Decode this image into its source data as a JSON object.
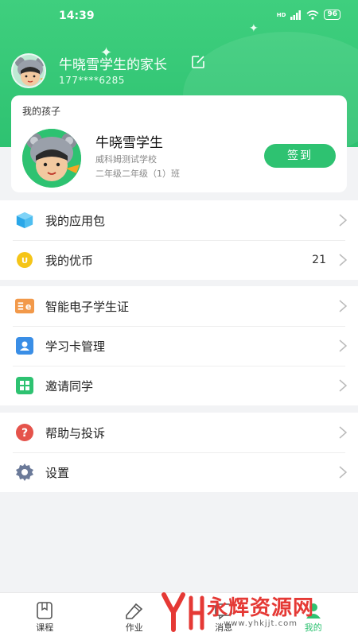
{
  "status_bar": {
    "time": "14:39",
    "network": "HD",
    "battery": "96"
  },
  "profile": {
    "parent_name": "牛晓雪学生的家长",
    "phone": "177****6285"
  },
  "child_card": {
    "section_label": "我的孩子",
    "child_name": "牛晓雪学生",
    "school": "威科姆测试学校",
    "class_name": "二年级二年级（1）班",
    "checkin_label": "签到"
  },
  "menu_group_1": [
    {
      "label": "我的应用包",
      "icon": "app-package-icon",
      "value": ""
    },
    {
      "label": "我的优币",
      "icon": "coin-icon",
      "value": "21"
    }
  ],
  "menu_group_2": [
    {
      "label": "智能电子学生证",
      "icon": "e-card-icon"
    },
    {
      "label": "学习卡管理",
      "icon": "id-card-icon"
    },
    {
      "label": "邀请同学",
      "icon": "invite-icon"
    }
  ],
  "menu_group_3": [
    {
      "label": "帮助与投诉",
      "icon": "help-icon"
    },
    {
      "label": "设置",
      "icon": "gear-icon"
    }
  ],
  "tabbar": [
    {
      "label": "课程",
      "icon": "course-icon"
    },
    {
      "label": "作业",
      "icon": "homework-icon"
    },
    {
      "label": "消息",
      "icon": "message-icon"
    },
    {
      "label": "我的",
      "icon": "profile-icon"
    }
  ],
  "watermark": {
    "text": "永辉资源网",
    "url": "www.yhkjjt.com"
  },
  "colors": {
    "brand_green": "#2ec271",
    "background": "#f2f3f5",
    "chevron": "#bbbbbb"
  }
}
